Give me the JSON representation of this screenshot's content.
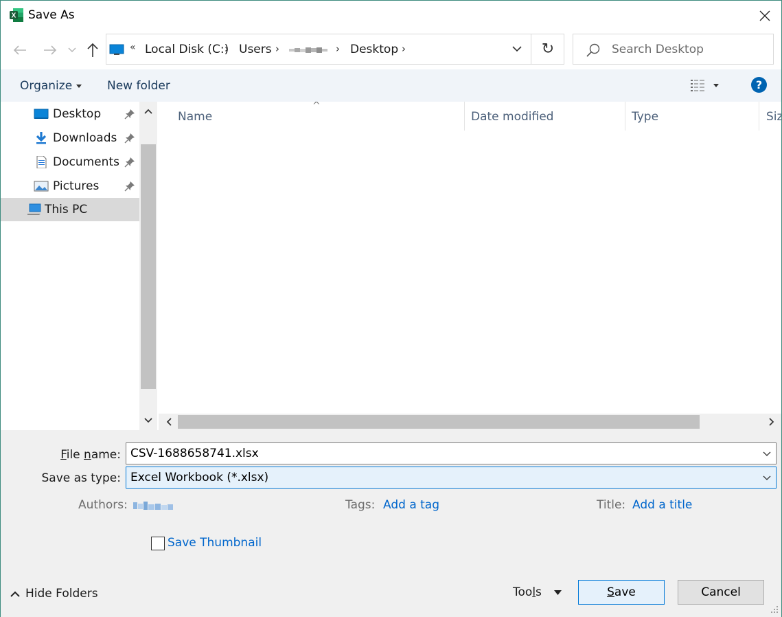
{
  "window": {
    "title": "Save As",
    "close_label": "×"
  },
  "nav": {
    "back_label": "←",
    "forward_label": "→",
    "recent_label": "⌄",
    "up_label": "↑",
    "overflow_label": "«",
    "breadcrumbs": [
      "Local Disk (C:)",
      "Users",
      "Desktop"
    ],
    "separator": "›",
    "refresh_label": "↻"
  },
  "search": {
    "placeholder": "Search Desktop"
  },
  "toolbar": {
    "organize_label": "Organize",
    "new_folder_label": "New folder",
    "help_label": "?"
  },
  "sidebar": {
    "items": [
      {
        "label": "Desktop",
        "icon": "desktop-icon",
        "pinned": true
      },
      {
        "label": "Downloads",
        "icon": "download-arrow-icon",
        "pinned": true
      },
      {
        "label": "Documents",
        "icon": "document-icon",
        "pinned": true
      },
      {
        "label": "Pictures",
        "icon": "pictures-icon",
        "pinned": true
      },
      {
        "label": "This PC",
        "icon": "computer-icon",
        "pinned": false,
        "selected": true
      }
    ]
  },
  "filelist": {
    "columns": [
      "Name",
      "Date modified",
      "Type",
      "Size"
    ]
  },
  "form": {
    "file_name_label": "File name:",
    "file_name_value": "CSV-1688658741.xlsx",
    "save_type_label": "Save as type:",
    "save_type_value": "Excel Workbook (*.xlsx)",
    "authors_label": "Authors:",
    "tags_label": "Tags:",
    "tags_link": "Add a tag",
    "title_label": "Title:",
    "title_link": "Add a title",
    "thumbnail_label": "Save Thumbnail",
    "thumbnail_checked": false
  },
  "footer": {
    "hide_folders_label": "Hide Folders",
    "tools_label": "Tools",
    "save_label": "Save",
    "cancel_label": "Cancel"
  },
  "colors": {
    "accent": "#0078d7",
    "link": "#0066cc",
    "excel_green": "#1d6f42",
    "toolbar_bg": "#f0f4f9",
    "selected_bg": "#d9d9d9"
  }
}
